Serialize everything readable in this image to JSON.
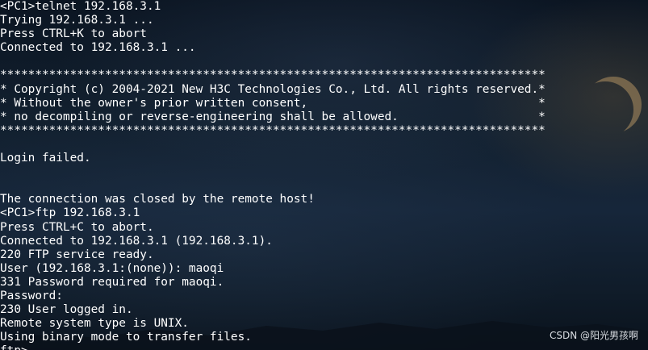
{
  "terminal": {
    "lines": [
      "<PC1>telnet 192.168.3.1",
      "Trying 192.168.3.1 ...",
      "Press CTRL+K to abort",
      "Connected to 192.168.3.1 ...",
      "",
      "******************************************************************************",
      "* Copyright (c) 2004-2021 New H3C Technologies Co., Ltd. All rights reserved.*",
      "* Without the owner's prior written consent,                                 *",
      "* no decompiling or reverse-engineering shall be allowed.                    *",
      "******************************************************************************",
      "",
      "Login failed.",
      "",
      "",
      "The connection was closed by the remote host!",
      "<PC1>ftp 192.168.3.1",
      "Press CTRL+C to abort.",
      "Connected to 192.168.3.1 (192.168.3.1).",
      "220 FTP service ready.",
      "User (192.168.3.1:(none)): maoqi",
      "331 Password required for maoqi.",
      "Password:",
      "230 User logged in.",
      "Remote system type is UNIX.",
      "Using binary mode to transfer files.",
      "ftp>"
    ]
  },
  "watermark": {
    "text": "CSDN @阳光男孩啊"
  }
}
